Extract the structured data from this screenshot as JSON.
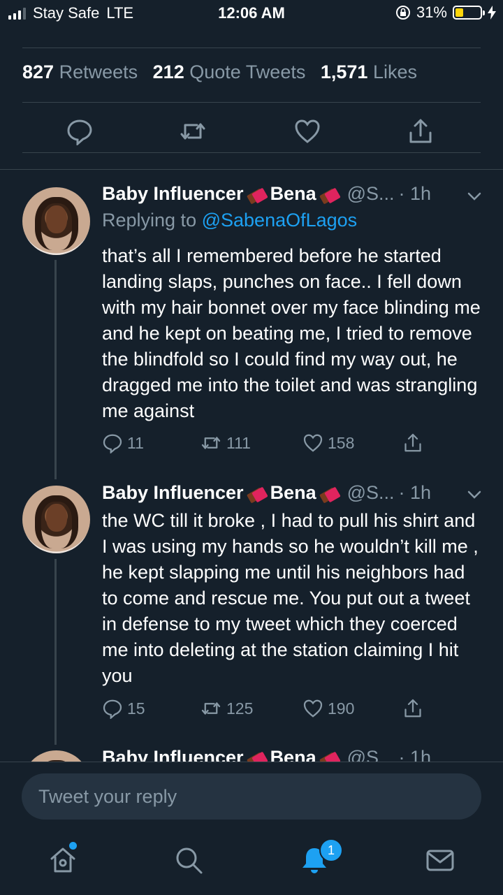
{
  "status_bar": {
    "carrier": "Stay Safe",
    "network": "LTE",
    "time": "12:06 AM",
    "battery": "31%",
    "battery_level": 0.31
  },
  "stats": {
    "retweets_count": "827",
    "retweets_label": "Retweets",
    "quotes_count": "212",
    "quotes_label": "Quote Tweets",
    "likes_count": "1,571",
    "likes_label": "Likes"
  },
  "tweets": [
    {
      "name": "Baby Influencer",
      "name2": "Bena",
      "handle": "@S...",
      "time": "· 1h",
      "reply_prefix": "Replying to",
      "reply_mention": "@SabenaOfLagos",
      "text": "that’s all I remembered before he started landing slaps, punches on face.. I fell down with my hair bonnet over my face blinding me and he kept on beating me, I tried to remove the blindfold so I could find my way out, he dragged me into the toilet and was strangling me against",
      "replies": "11",
      "retweets": "111",
      "likes": "158"
    },
    {
      "name": "Baby Influencer",
      "name2": "Bena",
      "handle": "@S...",
      "time": "· 1h",
      "text": "the WC till it broke , I had to pull his shirt and I was using my hands so he wouldn’t kill me , he kept slapping me until his neighbors had to come and rescue me. You put out a tweet in defense to my tweet which they coerced me into deleting at the station claiming I hit you",
      "replies": "15",
      "retweets": "125",
      "likes": "190"
    },
    {
      "name": "Baby Influencer",
      "name2": "Bena",
      "handle": "@S...",
      "time": "· 1h"
    }
  ],
  "reply_bar": {
    "placeholder": "Tweet your reply"
  },
  "tabbar": {
    "notification_count": "1"
  },
  "colors": {
    "background": "#15202b",
    "accent": "#1da1f2",
    "muted": "#8899a6",
    "divider": "#38444d"
  }
}
